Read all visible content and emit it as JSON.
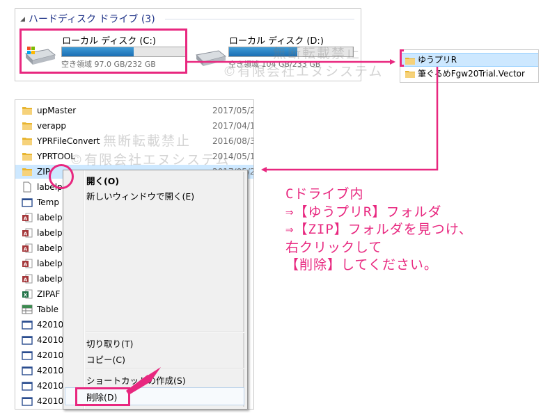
{
  "drives": {
    "header": "ハードディスク ドライブ (3)",
    "items": [
      {
        "name": "ローカル ディスク (C:)",
        "free": "空き領域 97.0 GB/232 GB",
        "used_fraction": 0.58
      },
      {
        "name": "ローカル ディスク (D:)",
        "free": "空き領域 104 GB/233 GB",
        "used_fraction": 0.55
      }
    ]
  },
  "mini_list": {
    "items": [
      {
        "label": "ゆうプリR",
        "selected": true
      },
      {
        "label": "筆ぐるめFgw20Trial.Vector",
        "selected": false
      }
    ]
  },
  "files": [
    {
      "name": "upMaster",
      "date": "2017/05/2",
      "icon": "folder-icon"
    },
    {
      "name": "verapp",
      "date": "2017/04/1",
      "icon": "folder-icon"
    },
    {
      "name": "YPRFileConvert",
      "date": "2016/08/3",
      "icon": "folder-icon"
    },
    {
      "name": "YPRTOOL",
      "date": "2014/05/1",
      "icon": "folder-icon"
    },
    {
      "name": "ZIP",
      "date": "2017/05/2",
      "icon": "folder-icon",
      "selected": true
    },
    {
      "name": "labelp",
      "date": "/2",
      "icon": "document-icon"
    },
    {
      "name": "Temp",
      "date": "/2",
      "icon": "window-icon"
    },
    {
      "name": "labelp",
      "date": "/2",
      "icon": "access-icon"
    },
    {
      "name": "labelp",
      "date": "/2",
      "icon": "access-icon"
    },
    {
      "name": "labelp",
      "date": "/2",
      "icon": "access-icon"
    },
    {
      "name": "labelp",
      "date": "/2",
      "icon": "access-icon"
    },
    {
      "name": "labelp",
      "date": "/2",
      "icon": "access-icon"
    },
    {
      "name": "ZIPAF",
      "date": "/2",
      "icon": "excel-icon"
    },
    {
      "name": "Table",
      "date": "/2",
      "icon": "table-icon"
    },
    {
      "name": "42010",
      "date": "/2",
      "icon": "window-icon"
    },
    {
      "name": "42010",
      "date": "/2",
      "icon": "window-icon"
    },
    {
      "name": "42010",
      "date": "/2",
      "icon": "window-icon"
    },
    {
      "name": "42010",
      "date": "/2",
      "icon": "window-icon"
    },
    {
      "name": "42010",
      "date": "/2",
      "icon": "window-icon"
    },
    {
      "name": "42010",
      "date": "/2",
      "icon": "window-icon"
    }
  ],
  "context_menu": {
    "open": "開く(O)",
    "open_new_window": "新しいウィンドウで開く(E)",
    "cut": "切り取り(T)",
    "copy": "コピー(C)",
    "create_shortcut": "ショートカットの作成(S)",
    "delete": "削除(D)"
  },
  "watermarks": {
    "line1": "無断転載禁止",
    "line2": "©有限会社エヌシステム"
  },
  "instructions": [
    "Cドライブ内",
    "⇒【ゆうプリR】フォルダ",
    "⇒【ZIP】フォルダを見つけ、",
    "右クリックして",
    "【削除】してください。"
  ],
  "colors": {
    "accent": "#e8277f",
    "selection": "#cde8ff",
    "drive_bar": "#1b6eb3",
    "header_text": "#1e3287"
  }
}
